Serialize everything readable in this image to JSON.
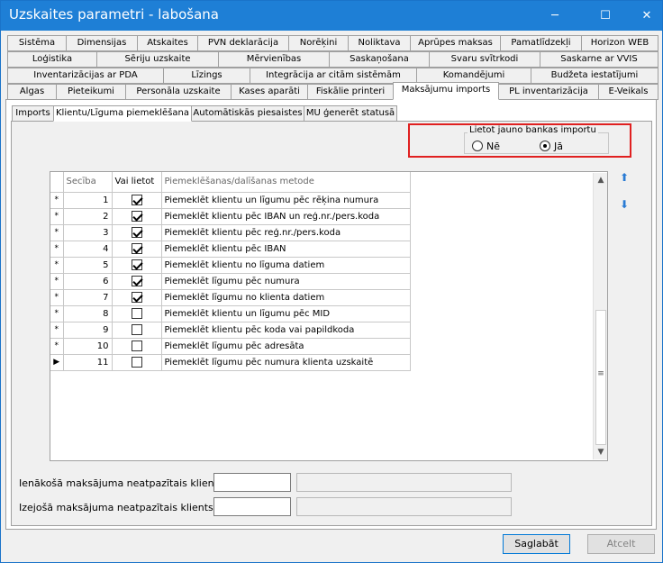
{
  "window": {
    "title": "Uzskaites parametri - labošana",
    "minimize": "─",
    "maximize": "☐",
    "close": "✕"
  },
  "tabs": {
    "row1": [
      "Sistēma",
      "Dimensijas",
      "Atskaites",
      "PVN deklarācija",
      "Norēķini",
      "Noliktava",
      "Aprūpes maksas",
      "Pamatlīdzekļi",
      "Horizon WEB"
    ],
    "row2": [
      "Loģistika",
      "Sēriju uzskaite",
      "Mērvienības",
      "Saskaņošana",
      "Svaru svītrkodi",
      "Saskarne ar VVIS"
    ],
    "row3": [
      "Inventarizācijas ar PDA",
      "Līzings",
      "Integrācija ar citām sistēmām",
      "Komandējumi",
      "Budžeta iestatījumi"
    ],
    "row4": [
      "Algas",
      "Pieteikumi",
      "Personāla uzskaite",
      "Kases aparāti",
      "Fiskālie printeri",
      "Maksājumu imports",
      "PL inventarizācija",
      "E-Veikals"
    ],
    "active": "Maksājumu imports"
  },
  "subtabs": {
    "items": [
      "Imports",
      "Klientu/Līguma piemeklēšana",
      "Automātiskās piesaistes",
      "MU ģenerēt statusā"
    ],
    "active": "Klientu/Līguma piemeklēšana"
  },
  "bank_import": {
    "legend": "Lietot jauno bankas importu",
    "option_no": "Nē",
    "option_yes": "Jā",
    "selected": "Jā"
  },
  "grid": {
    "headers": {
      "order": "Secība",
      "use": "Vai lietot",
      "method": "Piemeklēšanas/dalīšanas metode"
    },
    "rows": [
      {
        "indicator": "*",
        "order": "1",
        "use": true,
        "method": "Piemeklēt klientu un līgumu pēc rēķina numura"
      },
      {
        "indicator": "*",
        "order": "2",
        "use": true,
        "method": "Piemeklēt klientu pēc IBAN un reģ.nr./pers.koda"
      },
      {
        "indicator": "*",
        "order": "3",
        "use": true,
        "method": "Piemeklēt klientu pēc reģ.nr./pers.koda"
      },
      {
        "indicator": "*",
        "order": "4",
        "use": true,
        "method": "Piemeklēt klientu pēc IBAN"
      },
      {
        "indicator": "*",
        "order": "5",
        "use": true,
        "method": "Piemeklēt klientu no līguma datiem"
      },
      {
        "indicator": "*",
        "order": "6",
        "use": true,
        "method": "Piemeklēt līgumu pēc numura"
      },
      {
        "indicator": "*",
        "order": "7",
        "use": true,
        "method": "Piemeklēt līgumu no klienta datiem"
      },
      {
        "indicator": "*",
        "order": "8",
        "use": false,
        "method": "Piemeklēt klientu un līgumu pēc MID"
      },
      {
        "indicator": "*",
        "order": "9",
        "use": false,
        "method": "Piemeklēt klientu pēc koda vai papildkoda"
      },
      {
        "indicator": "*",
        "order": "10",
        "use": false,
        "method": "Piemeklēt līgumu pēc adresāta"
      },
      {
        "indicator": "▶",
        "order": "11",
        "use": false,
        "method": "Piemeklēt līgumu pēc numura klienta uzskaitē"
      }
    ]
  },
  "fields": {
    "incoming_label": "Ienākošā maksājuma neatpazītais klients:",
    "outgoing_label": "Izejošā maksājuma neatpazītais klients:",
    "incoming_value": "",
    "outgoing_value": ""
  },
  "buttons": {
    "save": "Saglabāt",
    "cancel": "Atcelt"
  },
  "icons": {
    "move_up": "arrow-up-icon",
    "move_down": "arrow-down-icon"
  },
  "colors": {
    "titlebar": "#1e7fd6",
    "highlight": "#e02020",
    "arrow": "#2a7bd4"
  }
}
